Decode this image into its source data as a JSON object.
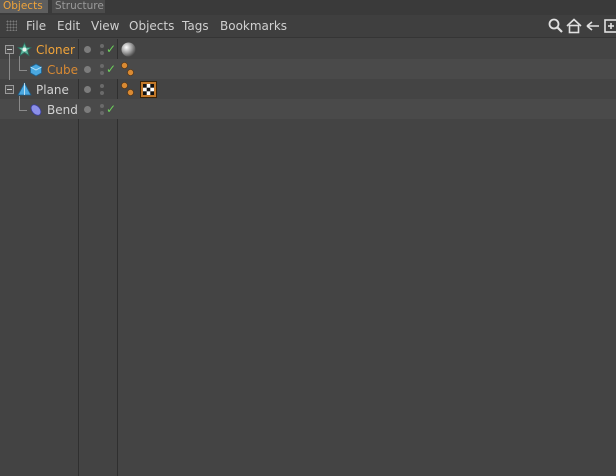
{
  "tabs": [
    {
      "label": "Objects",
      "active": true
    },
    {
      "label": "Structure",
      "active": false
    }
  ],
  "menu": [
    "File",
    "Edit",
    "View",
    "Objects",
    "Tags",
    "Bookmarks"
  ],
  "toolbar_icons": [
    "search-icon",
    "home-icon",
    "back-icon",
    "new-window-icon"
  ],
  "objects": [
    {
      "name": "Cloner",
      "icon": "cloner-icon",
      "level": 0,
      "color": "#f1a43a",
      "expanded": true,
      "enabled": true,
      "tags": [
        "phong-tag"
      ]
    },
    {
      "name": "Cube",
      "icon": "cube-icon",
      "level": 1,
      "color": "#d98a33",
      "enabled": true,
      "tags": [
        "phong-tag"
      ]
    },
    {
      "name": "Plane",
      "icon": "plane-icon",
      "level": 0,
      "color": "#d2d2d2",
      "expanded": true,
      "enabled": false,
      "tags": [
        "phong-tag",
        "texture-tag"
      ]
    },
    {
      "name": "Bend",
      "icon": "bend-icon",
      "level": 1,
      "color": "#d2d2d2",
      "enabled": true,
      "tags": []
    }
  ],
  "colors": {
    "accent": "#f1a43a",
    "check": "#6cd05a",
    "background": "#444444"
  }
}
